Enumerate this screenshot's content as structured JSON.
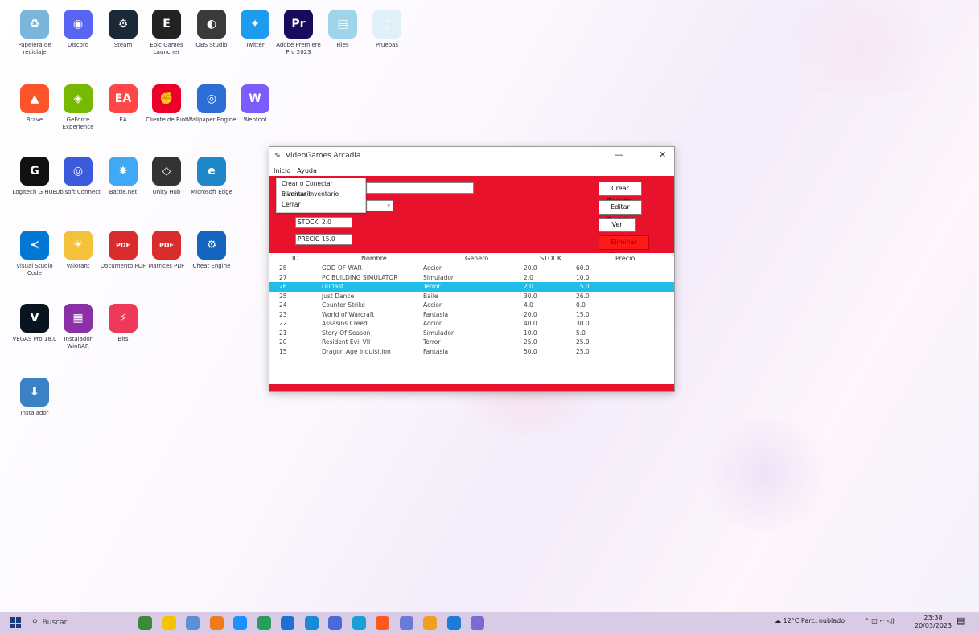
{
  "desktop_icons": [
    {
      "name": "icon-papelera",
      "label": "Papelera de reciclaje",
      "color": "#7ab6d9",
      "glyph": "♻"
    },
    {
      "name": "icon-discord",
      "label": "Discord",
      "color": "#5865f2",
      "glyph": "◉"
    },
    {
      "name": "icon-steam",
      "label": "Steam",
      "color": "#1b2838",
      "glyph": "⚙"
    },
    {
      "name": "icon-epic",
      "label": "Epic Games Launcher",
      "color": "#222222",
      "glyph": "E"
    },
    {
      "name": "icon-obs",
      "label": "OBS Studio",
      "color": "#3a3a3a",
      "glyph": "◐"
    },
    {
      "name": "icon-twitter",
      "label": "Twitter",
      "color": "#1d9bf0",
      "glyph": "✦"
    },
    {
      "name": "icon-premiere",
      "label": "Adobe Premiere Pro 2023",
      "color": "#1a0a5e",
      "glyph": "Pr"
    },
    {
      "name": "icon-file-1",
      "label": "Files",
      "color": "#9fd4ea",
      "glyph": "▤"
    },
    {
      "name": "icon-file-2",
      "label": "Pruebas",
      "color": "#dff0f8",
      "glyph": "▯"
    },
    {
      "name": "icon-brave",
      "label": "Brave",
      "color": "#fb542b",
      "glyph": "▲"
    },
    {
      "name": "icon-geforce",
      "label": "GeForce Experience",
      "color": "#76b900",
      "glyph": "◈"
    },
    {
      "name": "icon-ea",
      "label": "EA",
      "color": "#ff4747",
      "glyph": "EA"
    },
    {
      "name": "icon-riot",
      "label": "Cliente de Riot",
      "color": "#eb0029",
      "glyph": "✊"
    },
    {
      "name": "icon-wallpaper",
      "label": "Wallpaper Engine",
      "color": "#2b6fd6",
      "glyph": "◎"
    },
    {
      "name": "icon-webtool",
      "label": "Webtool",
      "color": "#7b5cff",
      "glyph": "W"
    },
    {
      "name": "icon-ghub",
      "label": "Logitech G HUB",
      "color": "#111111",
      "glyph": "G"
    },
    {
      "name": "icon-ubisoft",
      "label": "Ubisoft Connect",
      "color": "#3b5bdb",
      "glyph": "◎"
    },
    {
      "name": "icon-rainbow",
      "label": "Battle.net",
      "color": "#3fa9f5",
      "glyph": "✸"
    },
    {
      "name": "icon-unity",
      "label": "Unity Hub",
      "color": "#333333",
      "glyph": "◇"
    },
    {
      "name": "icon-edge",
      "label": "Microsoft Edge",
      "color": "#1e88c9",
      "glyph": "e"
    },
    {
      "name": "icon-vscode",
      "label": "Visual Studio Code",
      "color": "#0078d4",
      "glyph": "≺"
    },
    {
      "name": "icon-kaizen",
      "label": "Valorant",
      "color": "#f3c13a",
      "glyph": "☀"
    },
    {
      "name": "icon-pdf-1",
      "label": "Documento PDF",
      "color": "#d92c2c",
      "glyph": "PDF"
    },
    {
      "name": "icon-pdf-2",
      "label": "Matrices PDF",
      "color": "#d92c2c",
      "glyph": "PDF"
    },
    {
      "name": "icon-cheat",
      "label": "Cheat Engine",
      "color": "#1565c0",
      "glyph": "⚙"
    },
    {
      "name": "icon-vegas",
      "label": "VEGAS Pro 18.0",
      "color": "#08141f",
      "glyph": "V"
    },
    {
      "name": "icon-winrar",
      "label": "Instalador WinRAR",
      "color": "#8b2fa6",
      "glyph": "▦"
    },
    {
      "name": "icon-bluestacks",
      "label": "Bits",
      "color": "#f0385a",
      "glyph": "⚡"
    },
    {
      "name": "icon-installer",
      "label": "Instalador",
      "color": "#3b82c4",
      "glyph": "⬇"
    }
  ],
  "app": {
    "title": "VideoGames Arcadia",
    "menu": [
      "Inicio",
      "Ayuda"
    ],
    "dropdown": [
      "Crear o Conectar Inventario",
      "Eliminar Inventario",
      "Cerrar"
    ],
    "stock_label": "STOCK",
    "stock_value": "2.0",
    "precio_label": "PRECIO",
    "precio_value": "15.0",
    "buttons": {
      "crear": "Crear Registro",
      "editar": "Editar Registro",
      "ver": "Ver Registro",
      "eliminar": "Eliminar Registro"
    },
    "columns": {
      "id": "ID",
      "nombre": "Nombre",
      "genero": "Genero",
      "stock": "STOCK",
      "precio": "Precio"
    },
    "rows": [
      {
        "id": "28",
        "nombre": "GOD OF WAR",
        "genero": "Accion",
        "stock": "20.0",
        "precio": "60.0"
      },
      {
        "id": "27",
        "nombre": "PC BUILDING SIMULATOR",
        "genero": "Simulador",
        "stock": "2.0",
        "precio": "10.0"
      },
      {
        "id": "26",
        "nombre": "Outlast",
        "genero": "Terror",
        "stock": "2.0",
        "precio": "15.0",
        "selected": true
      },
      {
        "id": "25",
        "nombre": "Just Dance",
        "genero": "Baile",
        "stock": "30.0",
        "precio": "26.0"
      },
      {
        "id": "24",
        "nombre": "Counter Strike",
        "genero": "Accion",
        "stock": "4.0",
        "precio": "0.0"
      },
      {
        "id": "23",
        "nombre": "World of Warcraft",
        "genero": "Fantasia",
        "stock": "20.0",
        "precio": "15.0"
      },
      {
        "id": "22",
        "nombre": "Assasins Creed",
        "genero": "Accion",
        "stock": "40.0",
        "precio": "30.0"
      },
      {
        "id": "21",
        "nombre": "Story Of Season",
        "genero": "Simulador",
        "stock": "10.0",
        "precio": "5.0"
      },
      {
        "id": "20",
        "nombre": "Resident Evil VII",
        "genero": "Terror",
        "stock": "25.0",
        "precio": "25.0"
      },
      {
        "id": "15",
        "nombre": "Dragon Age Inquisition",
        "genero": "Fantasia",
        "stock": "50.0",
        "precio": "25.0"
      }
    ]
  },
  "taskbar": {
    "search_placeholder": "Buscar",
    "weather": "12°C Parc. nublado",
    "time": "23:38",
    "date": "20/03/2023"
  },
  "colors": {
    "accent_red": "#e8122d",
    "selected_row": "#1fbde8",
    "taskbar": "#d9cbe6"
  }
}
